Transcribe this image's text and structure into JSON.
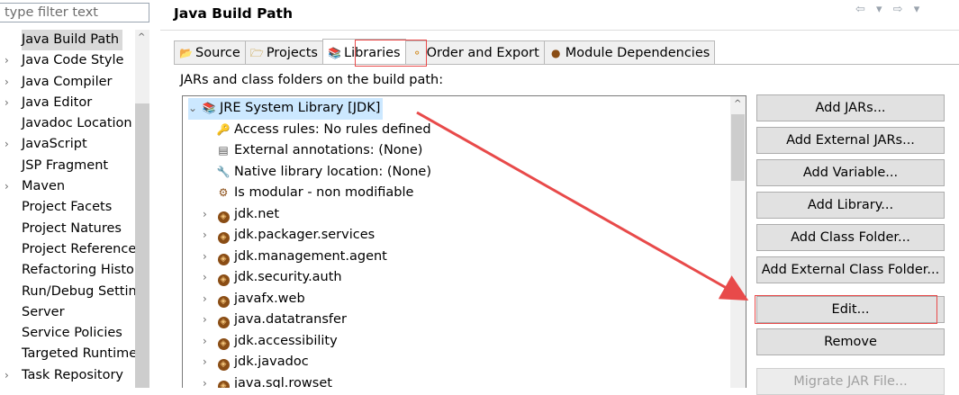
{
  "filter": {
    "placeholder": "type filter text"
  },
  "nav": {
    "items": [
      {
        "label": "Java Build Path",
        "chev": "",
        "selected": true
      },
      {
        "label": "Java Code Style",
        "chev": "›"
      },
      {
        "label": "Java Compiler",
        "chev": "›"
      },
      {
        "label": "Java Editor",
        "chev": "›"
      },
      {
        "label": "Javadoc Location",
        "chev": ""
      },
      {
        "label": "JavaScript",
        "chev": "›"
      },
      {
        "label": "JSP Fragment",
        "chev": ""
      },
      {
        "label": "Maven",
        "chev": "›"
      },
      {
        "label": "Project Facets",
        "chev": ""
      },
      {
        "label": "Project Natures",
        "chev": ""
      },
      {
        "label": "Project References",
        "chev": ""
      },
      {
        "label": "Refactoring History",
        "chev": ""
      },
      {
        "label": "Run/Debug Settings",
        "chev": ""
      },
      {
        "label": "Server",
        "chev": ""
      },
      {
        "label": "Service Policies",
        "chev": ""
      },
      {
        "label": "Targeted Runtimes",
        "chev": ""
      },
      {
        "label": "Task Repository",
        "chev": "›"
      }
    ]
  },
  "header": {
    "title": "Java Build Path",
    "history": "⇦ ▾ ⇨ ▾"
  },
  "tabs": [
    {
      "label": "Source",
      "icon": "📂"
    },
    {
      "label": "Projects",
      "icon": "🗁"
    },
    {
      "label": "Libraries",
      "icon": "📚",
      "active": true
    },
    {
      "label": "Order and Export",
      "icon": "⚬"
    },
    {
      "label": "Module Dependencies",
      "icon": "●"
    }
  ],
  "subheader": "JARs and class folders on the build path:",
  "tree": {
    "rows": [
      {
        "label": "JRE System Library [JDK]",
        "twisty": "⌄",
        "indent": 0,
        "kind": "lib",
        "selected": true
      },
      {
        "label": "Access rules: No rules defined",
        "twisty": "",
        "indent": 1,
        "kind": "rules"
      },
      {
        "label": "External annotations: (None)",
        "twisty": "",
        "indent": 1,
        "kind": "annot"
      },
      {
        "label": "Native library location: (None)",
        "twisty": "",
        "indent": 1,
        "kind": "native"
      },
      {
        "label": "Is modular - non modifiable",
        "twisty": "",
        "indent": 1,
        "kind": "modular"
      },
      {
        "label": "jdk.net",
        "twisty": "›",
        "indent": 1,
        "kind": "module"
      },
      {
        "label": "jdk.packager.services",
        "twisty": "›",
        "indent": 1,
        "kind": "module"
      },
      {
        "label": "jdk.management.agent",
        "twisty": "›",
        "indent": 1,
        "kind": "module"
      },
      {
        "label": "jdk.security.auth",
        "twisty": "›",
        "indent": 1,
        "kind": "module"
      },
      {
        "label": "javafx.web",
        "twisty": "›",
        "indent": 1,
        "kind": "module"
      },
      {
        "label": "java.datatransfer",
        "twisty": "›",
        "indent": 1,
        "kind": "module"
      },
      {
        "label": "jdk.accessibility",
        "twisty": "›",
        "indent": 1,
        "kind": "module"
      },
      {
        "label": "jdk.javadoc",
        "twisty": "›",
        "indent": 1,
        "kind": "module"
      },
      {
        "label": "java.sql.rowset",
        "twisty": "›",
        "indent": 1,
        "kind": "module"
      }
    ]
  },
  "buttons": [
    {
      "label": "Add JARs...",
      "name": "add-jars-button"
    },
    {
      "label": "Add External JARs...",
      "name": "add-external-jars-button"
    },
    {
      "label": "Add Variable...",
      "name": "add-variable-button"
    },
    {
      "label": "Add Library...",
      "name": "add-library-button"
    },
    {
      "label": "Add Class Folder...",
      "name": "add-class-folder-button"
    },
    {
      "label": "Add External Class Folder...",
      "name": "add-external-class-folder-button"
    },
    {
      "label": "Edit...",
      "name": "edit-button"
    },
    {
      "label": "Remove",
      "name": "remove-button"
    },
    {
      "label": "Migrate JAR File...",
      "name": "migrate-jar-file-button",
      "disabled": true
    }
  ],
  "annotation": {
    "color": "#e84a4a"
  }
}
